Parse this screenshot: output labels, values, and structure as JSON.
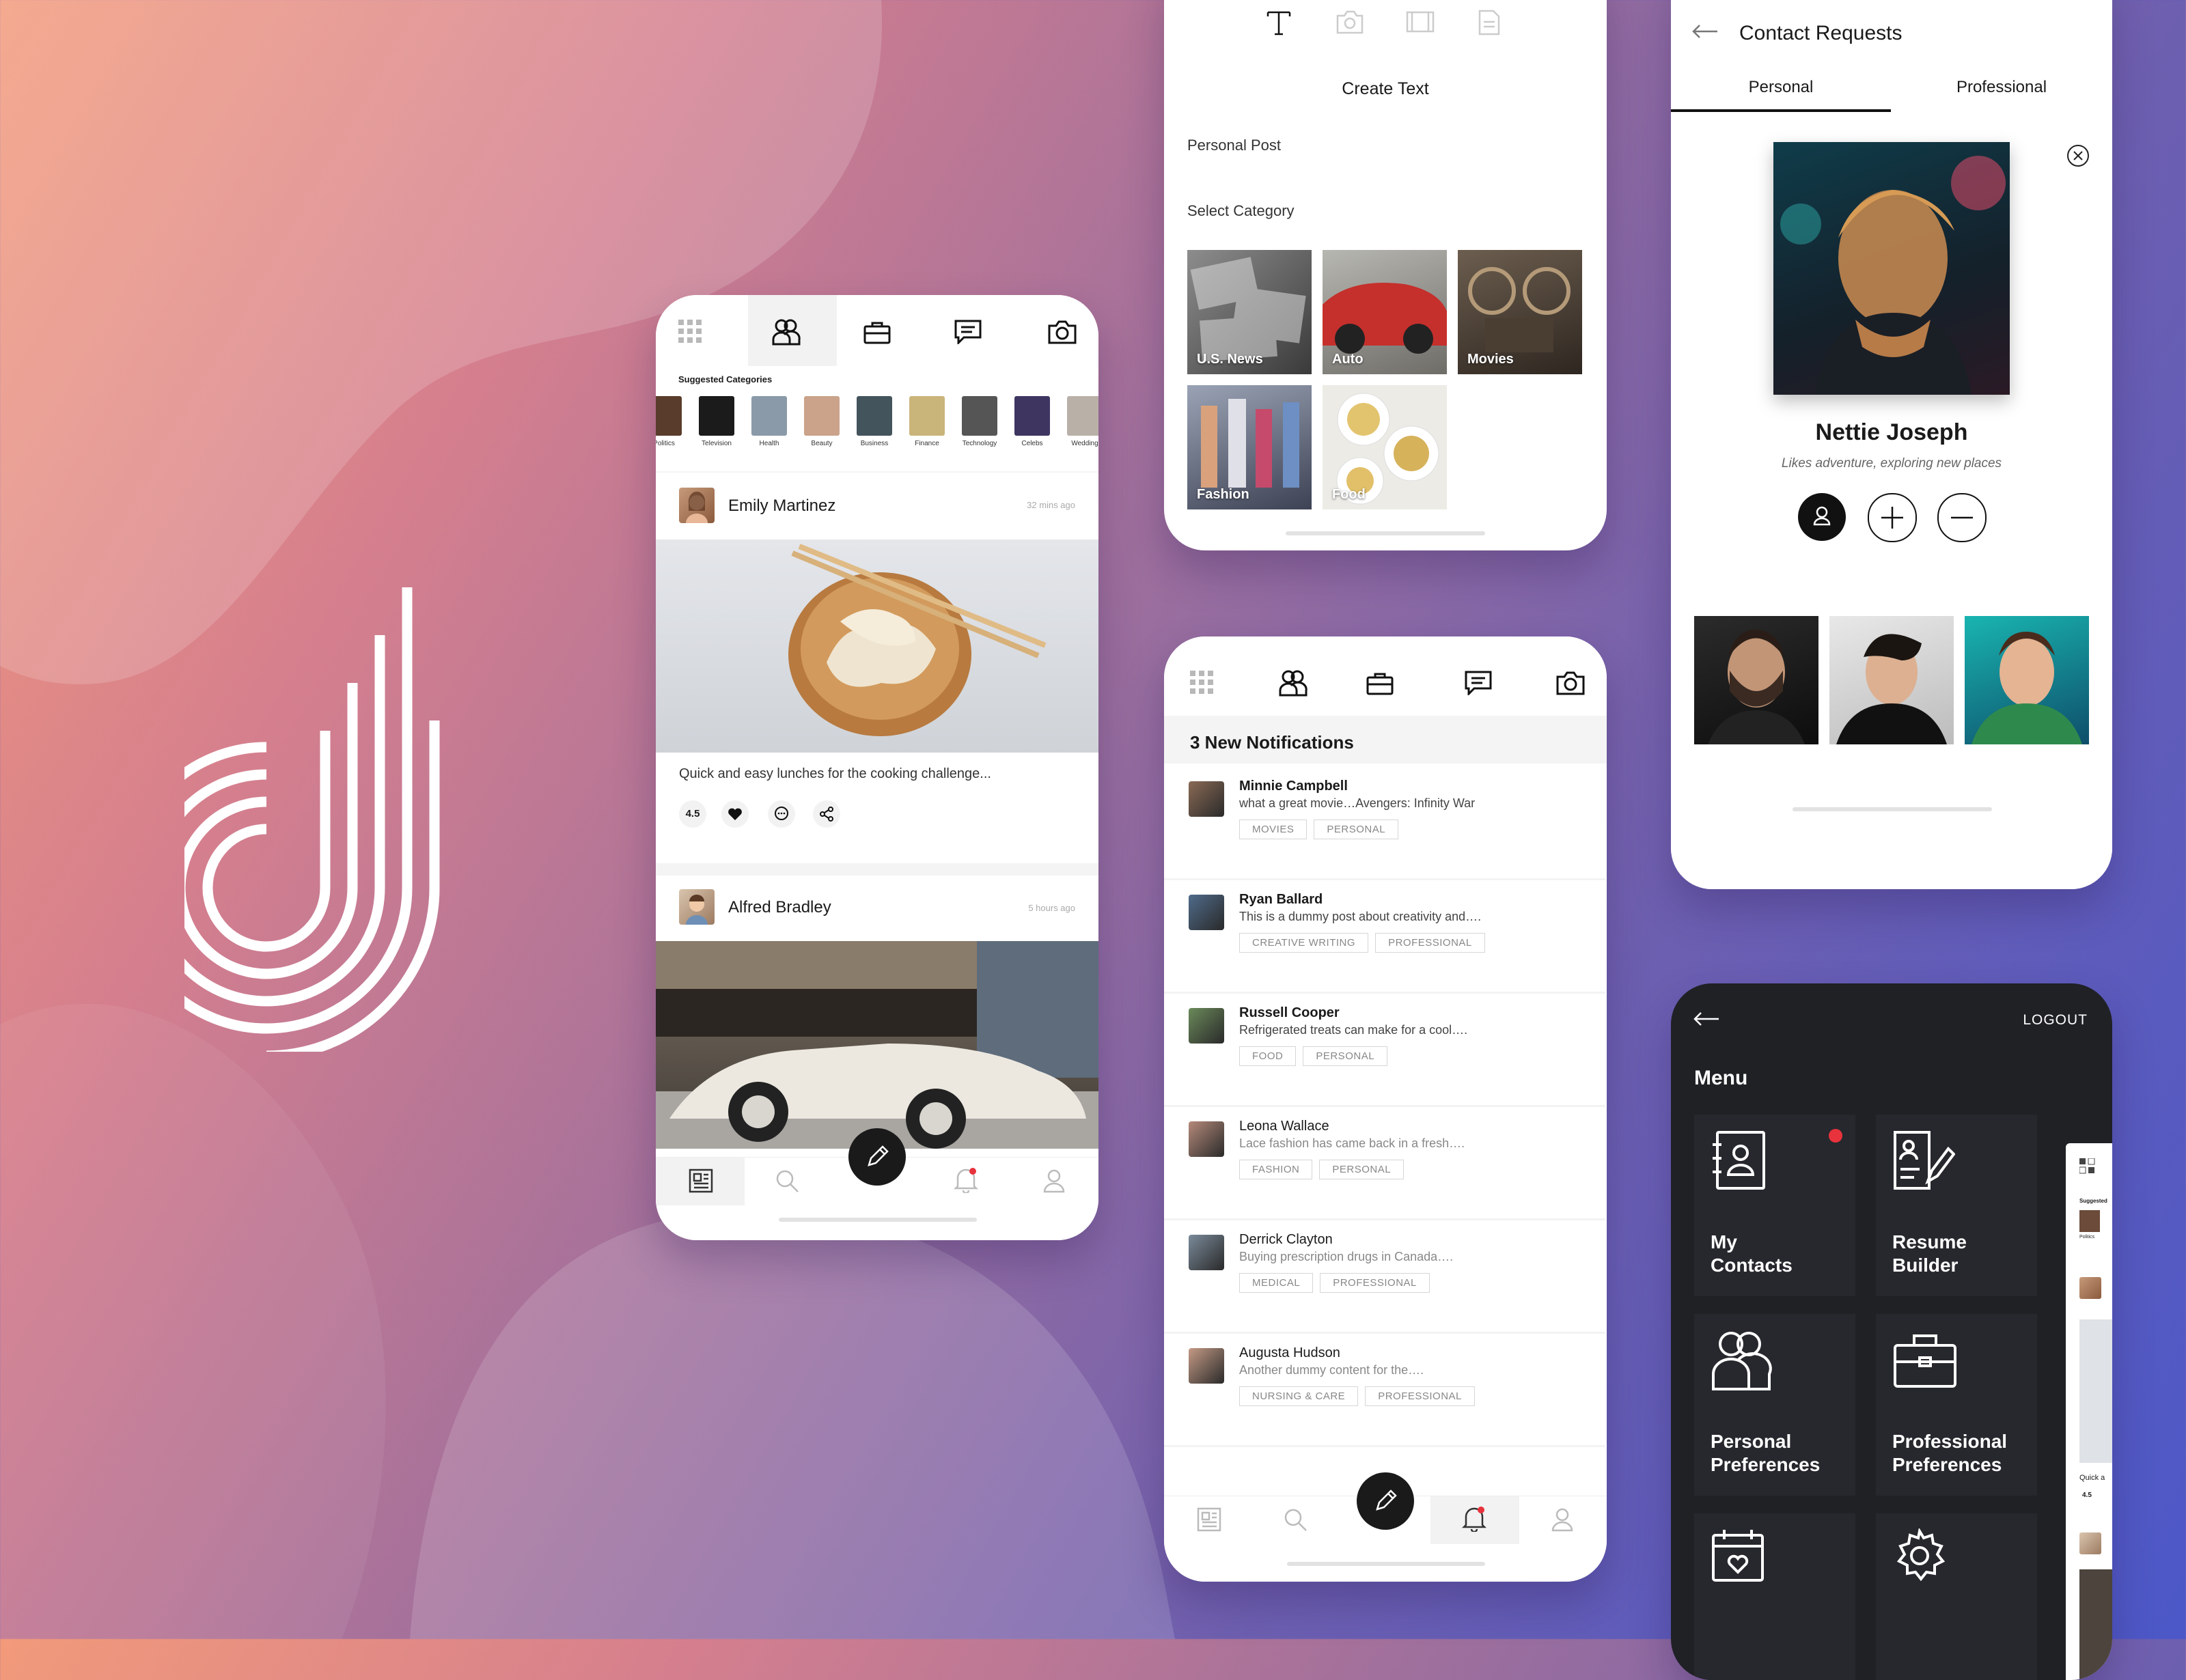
{
  "feed": {
    "section_title": "Suggested Categories",
    "categories": [
      "Politics",
      "Television",
      "Health",
      "Beauty",
      "Business",
      "Finance",
      "Technology",
      "Celebs",
      "Wedding"
    ],
    "posts": [
      {
        "author": "Emily Martinez",
        "time": "32 mins ago",
        "caption": "Quick and easy lunches for the cooking challenge...",
        "rating": "4.5"
      },
      {
        "author": "Alfred Bradley",
        "time": "5 hours ago"
      }
    ]
  },
  "create": {
    "title": "Create Text",
    "post_type": "Personal Post",
    "select_label": "Select Category",
    "categories": [
      "U.S. News",
      "Auto",
      "Movies",
      "Fashion",
      "Food"
    ]
  },
  "notifications": {
    "heading": "3 New Notifications",
    "items": [
      {
        "name": "Minnie Campbell",
        "text": "what a great movie…Avengers: Infinity War",
        "tags": [
          "MOVIES",
          "PERSONAL"
        ]
      },
      {
        "name": "Ryan Ballard",
        "text": "This is a dummy post about creativity and….",
        "tags": [
          "CREATIVE WRITING",
          "PROFESSIONAL"
        ]
      },
      {
        "name": "Russell Cooper",
        "text": "Refrigerated treats can make for a cool….",
        "tags": [
          "FOOD",
          "PERSONAL"
        ]
      },
      {
        "name": "Leona Wallace",
        "text": "Lace fashion has came back in a fresh….",
        "tags": [
          "FASHION",
          "PERSONAL"
        ]
      },
      {
        "name": "Derrick Clayton",
        "text": "Buying prescription drugs in Canada….",
        "tags": [
          "MEDICAL",
          "PROFESSIONAL"
        ]
      },
      {
        "name": "Augusta Hudson",
        "text": "Another dummy content for the….",
        "tags": [
          "NURSING & CARE",
          "PROFESSIONAL"
        ]
      }
    ]
  },
  "contact": {
    "title": "Contact Requests",
    "tabs": [
      "Personal",
      "Professional"
    ],
    "name": "Nettie Joseph",
    "bio": "Likes adventure, exploring new places"
  },
  "menu": {
    "logout": "LOGOUT",
    "title": "Menu",
    "tiles": [
      "My Contacts",
      "Resume Builder",
      "Personal Preferences",
      "Professional Preferences"
    ],
    "peek": {
      "section": "Suggested",
      "category": "Politics",
      "caption": "Quick a",
      "rating": "4.5"
    }
  },
  "colors": {
    "accent": "#e8323c",
    "dark": "#1f2125",
    "tile": "#26282d"
  }
}
